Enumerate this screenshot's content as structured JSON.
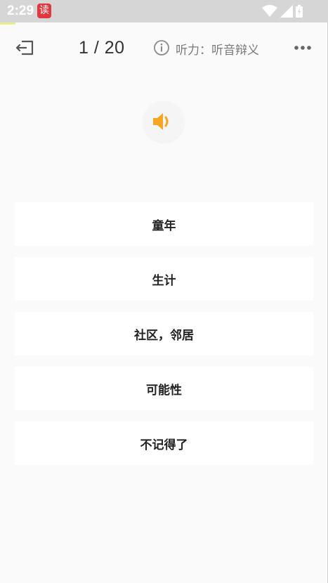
{
  "status_bar": {
    "time": "2:29",
    "app_badge": "读",
    "icons": [
      "wifi-icon",
      "signal-icon",
      "battery-icon"
    ]
  },
  "toolbar": {
    "counter": "1 / 20",
    "mode_label": "听力：听音辩义",
    "icons": [
      "exit-icon",
      "info-icon",
      "more-icon"
    ]
  },
  "audio": {
    "icon": "speaker-icon",
    "accent_color": "#f5a623"
  },
  "options": [
    {
      "label": "童年"
    },
    {
      "label": "生计"
    },
    {
      "label": "社区，邻居"
    },
    {
      "label": "可能性"
    },
    {
      "label": "不记得了"
    }
  ]
}
